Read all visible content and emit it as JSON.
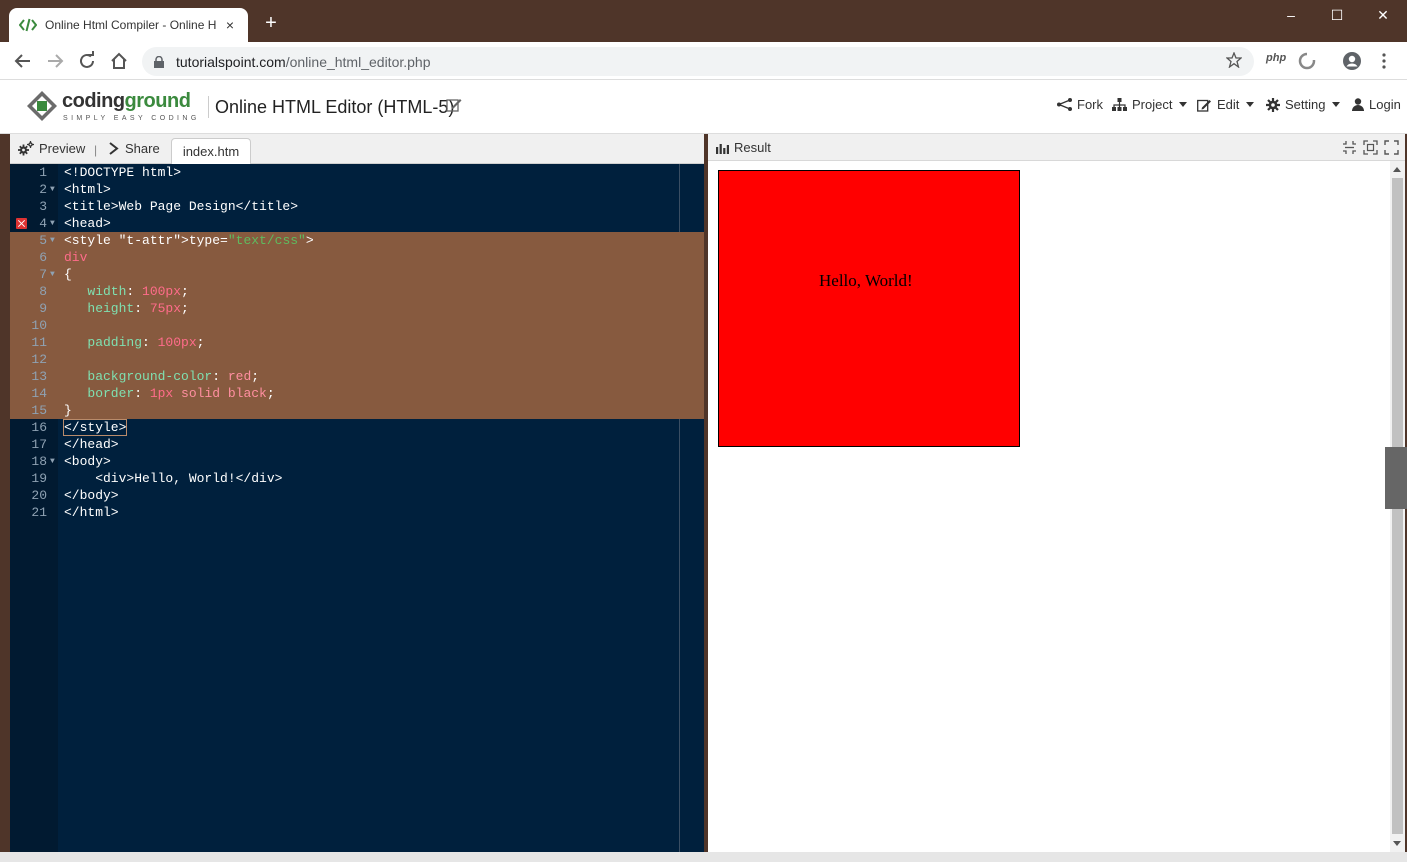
{
  "browser": {
    "tab_title": "Online Html Compiler - Online H",
    "close_glyph": "×",
    "new_tab_glyph": "+",
    "url_host": "tutorialspoint.com",
    "url_path": "/online_html_editor.php",
    "extension_label": "php",
    "window_controls": [
      "–",
      "☐",
      "✕"
    ]
  },
  "site": {
    "logo_word_a": "coding",
    "logo_word_b": "ground",
    "logo_tagline": "SIMPLY EASY CODING",
    "editor_title": "Online HTML Editor (HTML-5)",
    "menu": {
      "fork": "Fork",
      "project": "Project",
      "edit": "Edit",
      "setting": "Setting",
      "login": "Login"
    }
  },
  "left_toolbar": {
    "preview": "Preview",
    "separator": "|",
    "share": "Share",
    "file_tab": "index.htm"
  },
  "right_toolbar": {
    "result": "Result"
  },
  "code_lines": [
    "<!DOCTYPE html>",
    "<html>",
    "<title>Web Page Design</title>",
    "<head>",
    "<style type=\"text/css\">",
    "div",
    "{",
    "   width: 100px;",
    "   height: 75px;",
    "",
    "   padding: 100px;",
    "",
    "   background-color: red;",
    "   border: 1px solid black;",
    "}",
    "</style>",
    "</head>",
    "<body>",
    "    <div>Hello, World!</div>",
    "</body>",
    "</html>"
  ],
  "line_numbers": [
    "1",
    "2",
    "3",
    "4",
    "5",
    "6",
    "7",
    "8",
    "9",
    "10",
    "11",
    "12",
    "13",
    "14",
    "15",
    "16",
    "17",
    "18",
    "19",
    "20",
    "21"
  ],
  "preview": {
    "div_text": "Hello, World!"
  },
  "colors": {
    "editor_bg": "#00203d",
    "selection": "#875a3f",
    "accent_green": "#3b8a3e",
    "preview_box": "#ff0000"
  }
}
